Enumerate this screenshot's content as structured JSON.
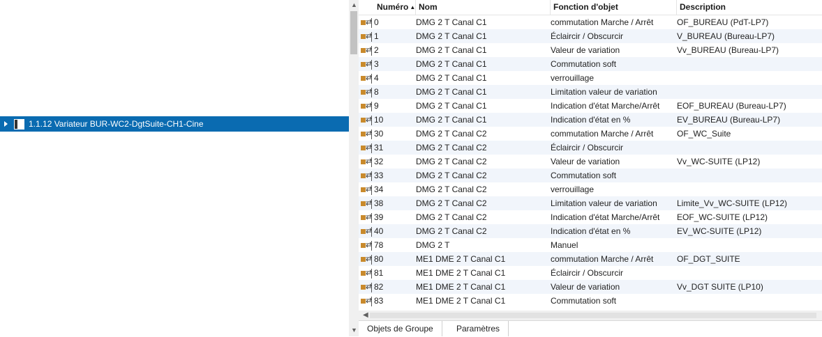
{
  "tree": {
    "selected_item": "1.1.12 Variateur BUR-WC2-DgtSuite-CH1-Cine"
  },
  "grid": {
    "columns": {
      "number": "Numéro",
      "name": "Nom",
      "function": "Fonction d'objet",
      "description": "Description"
    },
    "rows": [
      {
        "number": "0",
        "name": "DMG 2 T  Canal C1",
        "function": "commutation Marche / Arrêt",
        "description": "OF_BUREAU (PdT-LP7)"
      },
      {
        "number": "1",
        "name": "DMG 2 T  Canal C1",
        "function": "Éclaircir / Obscurcir",
        "description": "V_BUREAU (Bureau-LP7)"
      },
      {
        "number": "2",
        "name": "DMG 2 T  Canal C1",
        "function": "Valeur de variation",
        "description": "Vv_BUREAU (Bureau-LP7)"
      },
      {
        "number": "3",
        "name": "DMG 2 T  Canal C1",
        "function": "Commutation soft",
        "description": ""
      },
      {
        "number": "4",
        "name": "DMG 2 T  Canal C1",
        "function": "verrouillage",
        "description": ""
      },
      {
        "number": "8",
        "name": "DMG 2 T  Canal C1",
        "function": "Limitation valeur de variation",
        "description": ""
      },
      {
        "number": "9",
        "name": "DMG 2 T  Canal C1",
        "function": "Indication d'état Marche/Arrêt",
        "description": "EOF_BUREAU (Bureau-LP7)"
      },
      {
        "number": "10",
        "name": "DMG 2 T  Canal C1",
        "function": "Indication d'état en %",
        "description": "EV_BUREAU (Bureau-LP7)"
      },
      {
        "number": "30",
        "name": "DMG 2 T  Canal C2",
        "function": "commutation Marche / Arrêt",
        "description": "OF_WC_Suite"
      },
      {
        "number": "31",
        "name": "DMG 2 T  Canal C2",
        "function": "Éclaircir / Obscurcir",
        "description": ""
      },
      {
        "number": "32",
        "name": "DMG 2 T  Canal C2",
        "function": "Valeur de variation",
        "description": "Vv_WC-SUITE (LP12)"
      },
      {
        "number": "33",
        "name": "DMG 2 T  Canal C2",
        "function": "Commutation soft",
        "description": ""
      },
      {
        "number": "34",
        "name": "DMG 2 T  Canal C2",
        "function": "verrouillage",
        "description": ""
      },
      {
        "number": "38",
        "name": "DMG 2 T  Canal C2",
        "function": "Limitation valeur de variation",
        "description": "Limite_Vv_WC-SUITE (LP12)"
      },
      {
        "number": "39",
        "name": "DMG 2 T  Canal C2",
        "function": "Indication d'état Marche/Arrêt",
        "description": "EOF_WC-SUITE (LP12)"
      },
      {
        "number": "40",
        "name": "DMG 2 T  Canal C2",
        "function": "Indication d'état en %",
        "description": "EV_WC-SUITE (LP12)"
      },
      {
        "number": "78",
        "name": "DMG 2 T",
        "function": "Manuel",
        "description": ""
      },
      {
        "number": "80",
        "name": "ME1 DME 2 T  Canal C1",
        "function": "commutation Marche / Arrêt",
        "description": "OF_DGT_SUITE"
      },
      {
        "number": "81",
        "name": "ME1 DME 2 T  Canal C1",
        "function": "Éclaircir / Obscurcir",
        "description": ""
      },
      {
        "number": "82",
        "name": "ME1 DME 2 T  Canal C1",
        "function": "Valeur de variation",
        "description": "Vv_DGT SUITE (LP10)"
      },
      {
        "number": "83",
        "name": "ME1 DME 2 T  Canal C1",
        "function": "Commutation soft",
        "description": ""
      }
    ]
  },
  "tabs": {
    "group_objects": "Objets de Groupe",
    "parameters": "Paramètres"
  },
  "icons": {
    "row_icon": "group-object-icon",
    "device_icon": "device-icon",
    "sort_icon": "sort-ascending-icon"
  },
  "colors": {
    "selection": "#0a6bb1",
    "row_alt": "#f1f5fb",
    "object_icon": "#c98a2c"
  }
}
